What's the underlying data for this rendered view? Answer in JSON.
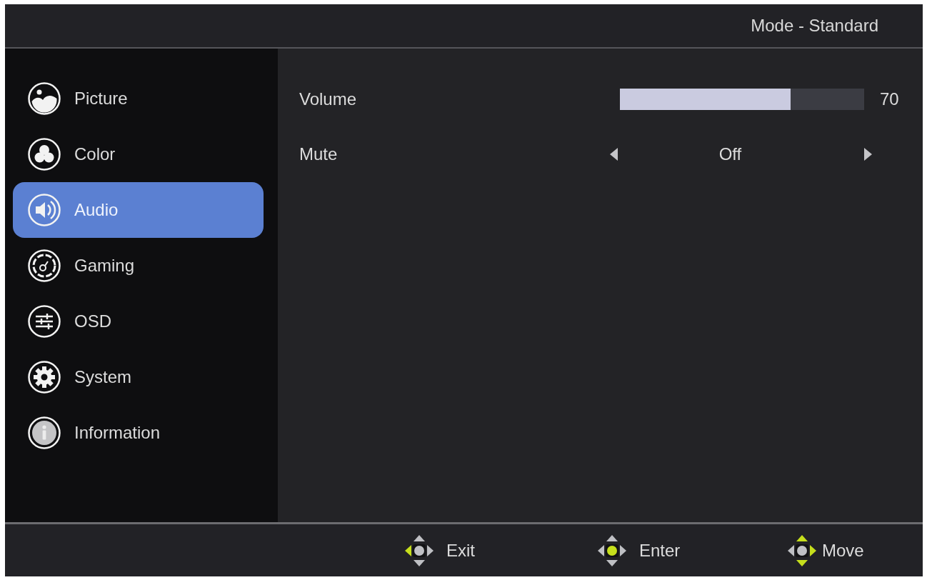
{
  "header": {
    "mode": "Mode - Standard"
  },
  "sidebar": {
    "items": [
      {
        "label": "Picture",
        "selected": false
      },
      {
        "label": "Color",
        "selected": false
      },
      {
        "label": "Audio",
        "selected": true
      },
      {
        "label": "Gaming",
        "selected": false
      },
      {
        "label": "OSD",
        "selected": false
      },
      {
        "label": "System",
        "selected": false
      },
      {
        "label": "Information",
        "selected": false
      }
    ]
  },
  "settings": [
    {
      "kind": "slider",
      "label": "Volume",
      "level": 0.7,
      "reading": "70"
    },
    {
      "kind": "selector",
      "label": "Mute",
      "value": "Off"
    }
  ],
  "footer": {
    "hints": [
      {
        "label": "Exit"
      },
      {
        "label": "Enter"
      },
      {
        "label": "Move"
      }
    ]
  }
}
